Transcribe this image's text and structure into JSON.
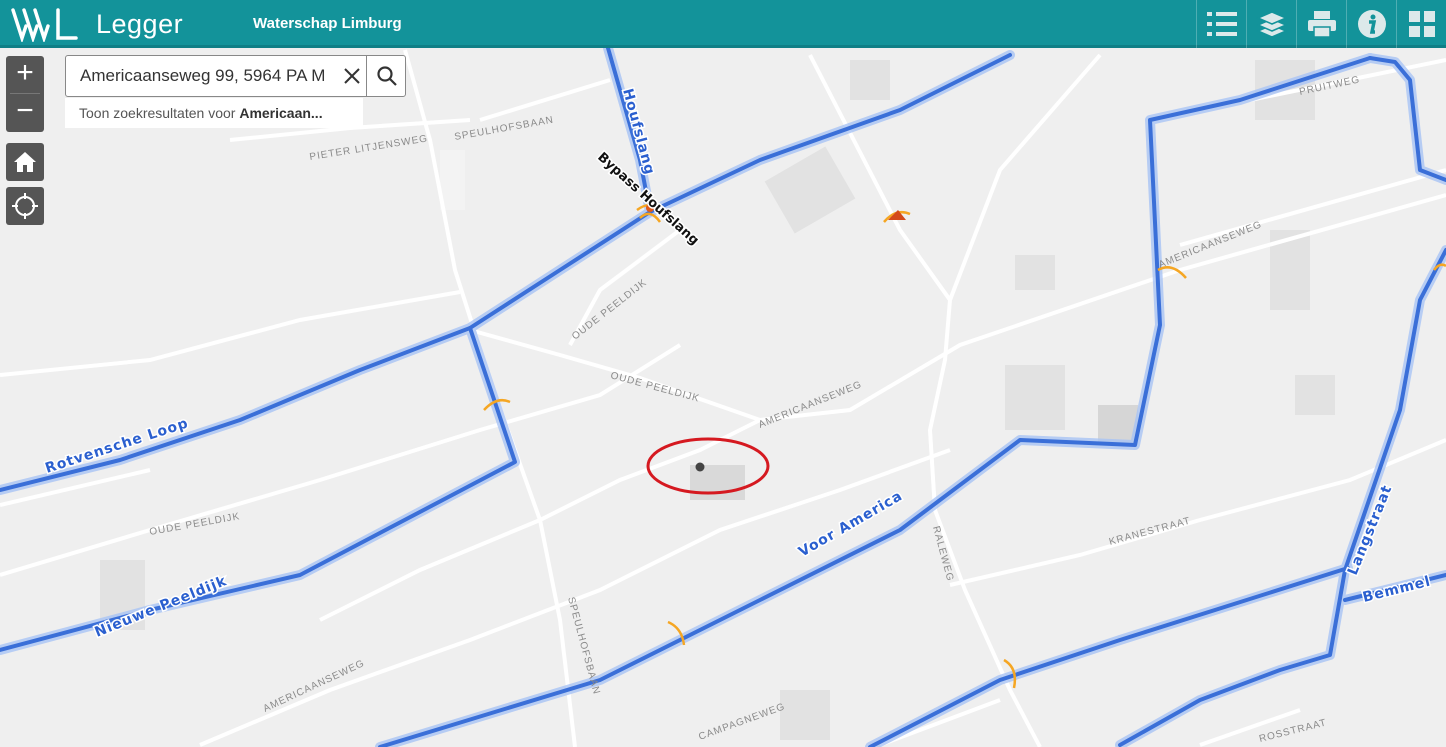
{
  "header": {
    "app_name": "Legger",
    "organization": "Waterschap Limburg",
    "toolbar": [
      {
        "name": "legend-list-icon"
      },
      {
        "name": "layers-icon"
      },
      {
        "name": "print-icon"
      },
      {
        "name": "info-icon"
      },
      {
        "name": "grid-menu-icon"
      }
    ]
  },
  "map_controls": {
    "zoom_in": "+",
    "zoom_out": "−"
  },
  "search": {
    "value": "Americaanseweg 99, 5964 PA M",
    "suggestion_prefix": "Toon zoekresultaten voor ",
    "suggestion_bold": "Americaan..."
  },
  "map_labels": {
    "waterways": [
      "Houfslang",
      "Bypass Houfslang",
      "Rotvensche Loop",
      "Nieuwe Peeldijk",
      "Voor America",
      "Langstraat",
      "Bemmel"
    ],
    "streets": [
      "PIETER LITJENSWEG",
      "SPEULHOFSBAAN",
      "OUDE PEELDIJK",
      "OUDE PEELDIJK",
      "OUDE PEELDIJK",
      "AMERICAANSEWEG",
      "AMERICAANSEWEG",
      "AMERICAANSEWEG",
      "KRANESTRAAT",
      "SPEULHOFSBAAN",
      "RALEWEG",
      "CAMPAGNEWEG",
      "PRUITWEG",
      "ROSSTRAAT"
    ]
  },
  "colors": {
    "header": "#13939a",
    "waterway": "#3a6fd8",
    "highlight_circle": "#d51920",
    "structure_marker": "#f5a623"
  }
}
